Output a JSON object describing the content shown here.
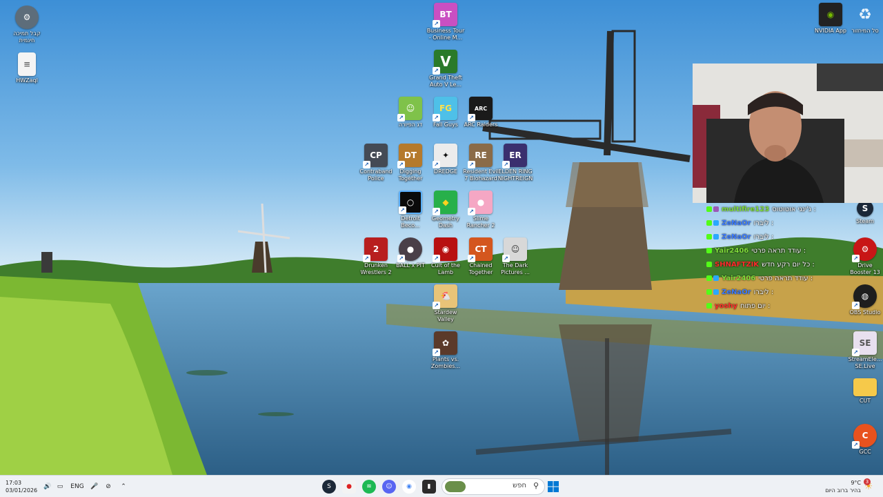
{
  "colors": {
    "accent": "#0078d4",
    "sky": "#4aa0dc",
    "taskbar": "#eef1f5"
  },
  "desktop_icons": {
    "left_1": {
      "label": "קבל תמיכה\nחינמית",
      "icon": "help-icon"
    },
    "left_2": {
      "label": "HWZaql",
      "icon": "file-icon"
    },
    "business_tour": {
      "label": "Business Tour\n- Online M...",
      "icon": "business-tour-icon"
    },
    "gta": {
      "label": "Grand Theft\nAuto V Le...",
      "icon": "gta-v-icon"
    },
    "hebrew_game": {
      "label": "דג הפיורה",
      "icon": "game-icon"
    },
    "fall_guys": {
      "label": "Fall Guys",
      "icon": "fall-guys-icon"
    },
    "arc_raiders": {
      "label": "ARC Raiders",
      "icon": "arc-raiders-icon"
    },
    "contraband": {
      "label": "Contraband\nPolice",
      "icon": "contraband-police-icon"
    },
    "digging": {
      "label": "Digging\nTogether",
      "icon": "digging-together-icon"
    },
    "dredge": {
      "label": "DREDGE",
      "icon": "dredge-icon"
    },
    "resident_evil": {
      "label": "Resident Evil\n7 Biohazard",
      "icon": "resident-evil-icon"
    },
    "elden_ring": {
      "label": "ELDEN RING\nNIGHTREIGN",
      "icon": "elden-ring-icon"
    },
    "detroit": {
      "label": "Detroit\nBeco...",
      "icon": "detroit-icon"
    },
    "geometry": {
      "label": "Geometry\nDash",
      "icon": "geometry-dash-icon"
    },
    "slime": {
      "label": "Slime\nRancher 2",
      "icon": "slime-rancher-icon"
    },
    "drunken": {
      "label": "Drunken\nWrestlers 2",
      "icon": "drunken-wrestlers-icon"
    },
    "balls": {
      "label": "BALL x PIT",
      "icon": "ball-x-pit-icon"
    },
    "cult": {
      "label": "Cult of the\nLamb",
      "icon": "cult-of-the-lamb-icon"
    },
    "chained": {
      "label": "Chained\nTogether",
      "icon": "chained-together-icon"
    },
    "dark_pictures": {
      "label": "The Dark\nPictures ...",
      "icon": "dark-pictures-icon"
    },
    "stardew": {
      "label": "Stardew\nValley",
      "icon": "stardew-valley-icon"
    },
    "plants": {
      "label": "Plants vs.\nZombies...",
      "icon": "plants-vs-zombies-icon"
    },
    "nvidia": {
      "label": "NVIDIA App",
      "icon": "nvidia-icon"
    },
    "recycle": {
      "label": "סל המיחזור",
      "icon": "recycle-bin-icon"
    },
    "steam": {
      "label": "Steam",
      "icon": "steam-icon"
    },
    "drive_boost": {
      "label": "Drive\nBooster 13",
      "icon": "drive-booster-icon"
    },
    "obs": {
      "label": "OBS Studio",
      "icon": "obs-icon"
    },
    "streamelements": {
      "label": "StreamEle...\nSE.Live",
      "icon": "streamelements-icon"
    },
    "cut": {
      "label": "CUT",
      "icon": "folder-icon"
    },
    "gcc": {
      "label": "GCC",
      "icon": "gcc-icon"
    }
  },
  "chat": [
    {
      "user": "multifire123",
      "color": "#7fdc3a",
      "msg": ": ג'ינגי אוטוטוס"
    },
    {
      "user": "ZeNaOr",
      "color": "#3b7bff",
      "msg": ": ליברו"
    },
    {
      "user": "ZeNaOr",
      "color": "#3b7bff",
      "msg": ": ליברו"
    },
    {
      "user": "Yair2406",
      "color": "#7fdc3a",
      "msg": ": עודד תראה פרטי"
    },
    {
      "user": "SHNAFTZIK",
      "color": "#ff2b2b",
      "msg": ": כל יום רקע חדש"
    },
    {
      "user": "Yair2406",
      "color": "#7fdc3a",
      "msg": ": עודד תראה פרטי"
    },
    {
      "user": "ZeNaOr",
      "color": "#3b7bff",
      "msg": ": ליברו"
    },
    {
      "user": "yoshy",
      "color": "#ff2b2b",
      "msg": ": יום פתוח"
    }
  ],
  "taskbar": {
    "time": "17:03",
    "date": "03/01/2026",
    "lang": "ENG",
    "search_placeholder": "חפש",
    "weather_temp": "9°C",
    "weather_desc": "בהיר ברוב היום",
    "notif_count": "3"
  }
}
